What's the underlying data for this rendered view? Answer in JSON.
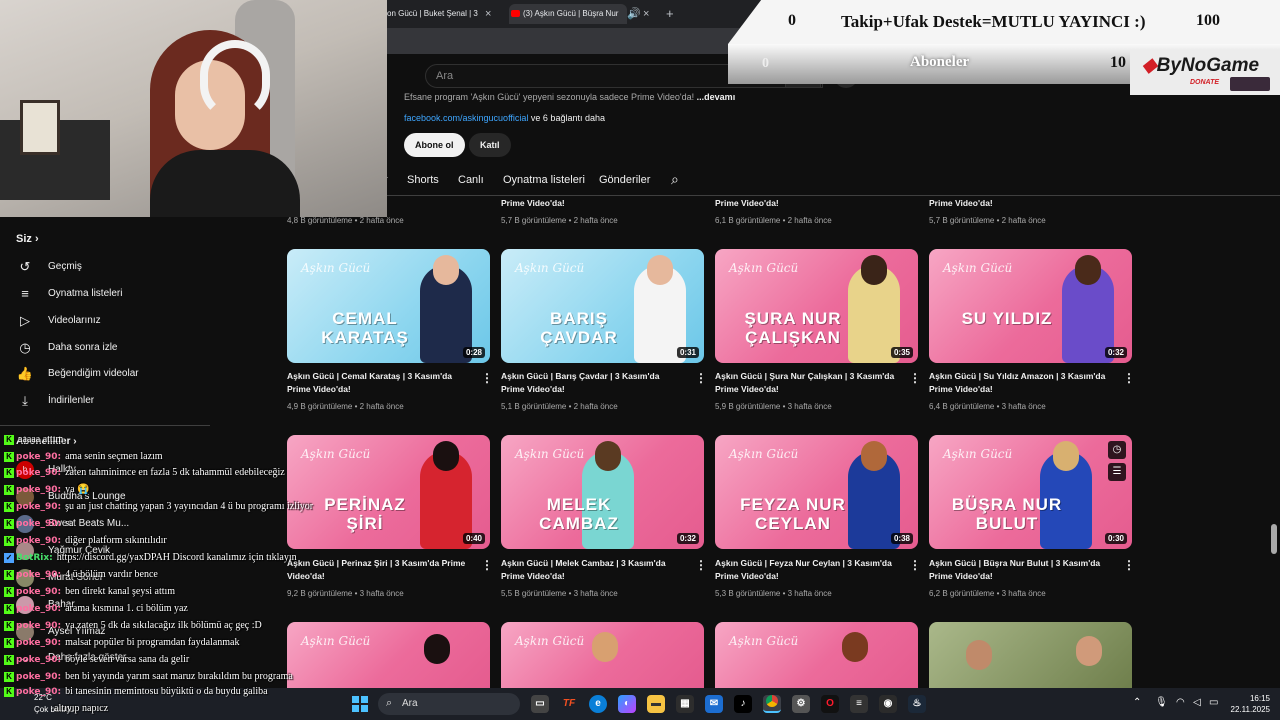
{
  "browser": {
    "tabs": [
      {
        "label": "on Gücü | Buket Şenal | 3",
        "close": "×"
      },
      {
        "label": "(3) Aşkın Gücü | Büşra Nur",
        "close": "×",
        "audio": "🔊"
      }
    ],
    "new_tab": "+"
  },
  "youtube": {
    "search_placeholder": "Ara",
    "description": "Efsane program 'Aşkın Gücü' yepyeni sezonuyla sadece Prime Video'da!",
    "description_more": "...devamı",
    "facebook_link": "facebook.com/askingucuofficial",
    "links_more": "ve 6 bağlantı daha",
    "subscribe": "Abone ol",
    "join": "Katıl",
    "channel_tabs": [
      "r",
      "Shorts",
      "Canlı",
      "Oynatma listeleri",
      "Gönderiler"
    ]
  },
  "sidebar": {
    "you": "Siz",
    "items": [
      {
        "icon": "history-icon",
        "label": "Geçmiş"
      },
      {
        "icon": "playlists-icon",
        "label": "Oynatma listeleri"
      },
      {
        "icon": "your-videos-icon",
        "label": "Videolarınız"
      },
      {
        "icon": "watch-later-icon",
        "label": "Daha sonra izle"
      },
      {
        "icon": "liked-icon",
        "label": "Beğendiğim videolar"
      },
      {
        "icon": "downloads-icon",
        "label": "İndirilenler"
      }
    ],
    "subs_heading": "Abonelikler",
    "subs": [
      "Halktv",
      "Buddha's Lounge",
      "Sweet Beats Mu...",
      "Yağmur Çevik",
      "Murat Soner",
      "Bahar",
      "Aysel Yılmaz"
    ],
    "show_more": "Daha fazla göster"
  },
  "top_row_meta": [
    {
      "title": "Prime Video'da!",
      "meta": "4,8 B görüntüleme • 2 hafta önce"
    },
    {
      "title": "Prime Video'da!",
      "meta": "5,7 B görüntüleme • 2 hafta önce"
    },
    {
      "title": "Prime Video'da!",
      "meta": "6,1 B görüntüleme • 2 hafta önce"
    },
    {
      "title": "Prime Video'da!",
      "meta": "5,7 B görüntüleme • 2 hafta önce"
    }
  ],
  "videos": [
    {
      "name": "CEMAL KARATAŞ",
      "duration": "0:28",
      "title": "Aşkın Gücü | Cemal Karataş | 3 Kasım'da Prime Video'da!",
      "meta": "4,9 B görüntüleme • 2 hafta önce",
      "bg": "blue"
    },
    {
      "name": "BARIŞ ÇAVDAR",
      "duration": "0:31",
      "title": "Aşkın Gücü | Barış Çavdar | 3 Kasım'da Prime Video'da!",
      "meta": "5,1 B görüntüleme • 2 hafta önce",
      "bg": "blue"
    },
    {
      "name": "ŞURA NUR ÇALIŞKAN",
      "duration": "0:35",
      "title": "Aşkın Gücü | Şura Nur Çalışkan | 3 Kasım'da Prime Video'da!",
      "meta": "5,9 B görüntüleme • 3 hafta önce",
      "bg": "pink"
    },
    {
      "name": "SU YILDIZ",
      "duration": "0:32",
      "title": "Aşkın Gücü | Su Yıldız Amazon | 3 Kasım'da Prime Video'da!",
      "meta": "6,4 B görüntüleme • 3 hafta önce",
      "bg": "pink"
    },
    {
      "name": "PERİNAZ ŞİRİ",
      "duration": "0:40",
      "title": "Aşkın Gücü | Perinaz Şiri | 3 Kasım'da Prime Video'da!",
      "meta": "9,2 B görüntüleme • 3 hafta önce",
      "bg": "pink"
    },
    {
      "name": "MELEK CAMBAZ",
      "duration": "0:32",
      "title": "Aşkın Gücü | Melek Cambaz | 3 Kasım'da Prime Video'da!",
      "meta": "5,5 B görüntüleme • 3 hafta önce",
      "bg": "pink"
    },
    {
      "name": "FEYZA NUR CEYLAN",
      "duration": "0:38",
      "title": "Aşkın Gücü | Feyza Nur Ceylan | 3 Kasım'da Prime Video'da!",
      "meta": "5,3 B görüntüleme • 3 hafta önce",
      "bg": "pink"
    },
    {
      "name": "BÜŞRA NUR BULUT",
      "duration": "0:30",
      "title": "Aşkın Gücü | Büşra Nur Bulut | 3 Kasım'da Prime Video'da!",
      "meta": "6,2 B görüntüleme • 3 hafta önce",
      "bg": "pink"
    },
    {
      "bg": "pink"
    },
    {
      "bg": "pink"
    },
    {
      "bg": "pink"
    },
    {
      "bg": "green"
    }
  ],
  "thumb_logo": "Aşkın Gücü",
  "overlay": {
    "goal_start": "0",
    "goal_text": "Takip+Ufak Destek=MUTLU YAYINCI :)",
    "goal_end": "100",
    "sub_start": "0",
    "sub_text": "Aboneler",
    "sub_end": "10",
    "bynogame": "ByNoGame",
    "donate": "DONATE"
  },
  "chat": [
    {
      "user": "",
      "msg": "aaaaa attım"
    },
    {
      "user": "poke_90:",
      "msg": "ama senin seçmen lazım"
    },
    {
      "user": "poke_90:",
      "msg": "zaten tahminimce en fazla 5 dk tahammül edebileceğiz"
    },
    {
      "user": "poke_90:",
      "msg": "ya 😭"
    },
    {
      "user": "poke_90:",
      "msg": "şu an just chatting yapan 3 yayıncıdan 4 ü bu programı izliyor"
    },
    {
      "user": "poke_90:",
      "msg": "sa"
    },
    {
      "user": "poke_90:",
      "msg": "diğer platform sıkıntılıdır"
    },
    {
      "user": "BotRix:",
      "msg": "https://discord.gg/yaxDPAH Discord kanalımız için tıklayın",
      "bot": true
    },
    {
      "user": "poke_90:",
      "msg": "4 ü bölüm vardır bence"
    },
    {
      "user": "poke_90:",
      "msg": "ben direkt kanal şeysi attım"
    },
    {
      "user": "poke_90:",
      "msg": "arama kısmına 1. ci bölüm yaz"
    },
    {
      "user": "poke_90:",
      "msg": "ya zaten 5 dk da sıkılacağız ilk bölümü aç geç :D"
    },
    {
      "user": "poke_90:",
      "msg": "malsat popüler bi programdan faydalanmak"
    },
    {
      "user": "poke_90:",
      "msg": "böyle seven varsa sana da gelir"
    },
    {
      "user": "poke_90:",
      "msg": "ben bi yayında yarım saat maruz bırakıldım bu programa"
    },
    {
      "user": "poke_90:",
      "msg": "bi tanesinin memintosu büyüktü o da buydu galiba"
    },
    {
      "user": "",
      "msg": "altıyıp napıcz"
    }
  ],
  "taskbar": {
    "temp": "22°C",
    "weather": "Çok bulutlu",
    "search": "Ara",
    "time": "16:15",
    "date": "22.11.2025"
  },
  "colors": {
    "accent_link": "#3ea6ff",
    "kick_green": "#53fc18",
    "chat_user": "#ff6fa1"
  }
}
